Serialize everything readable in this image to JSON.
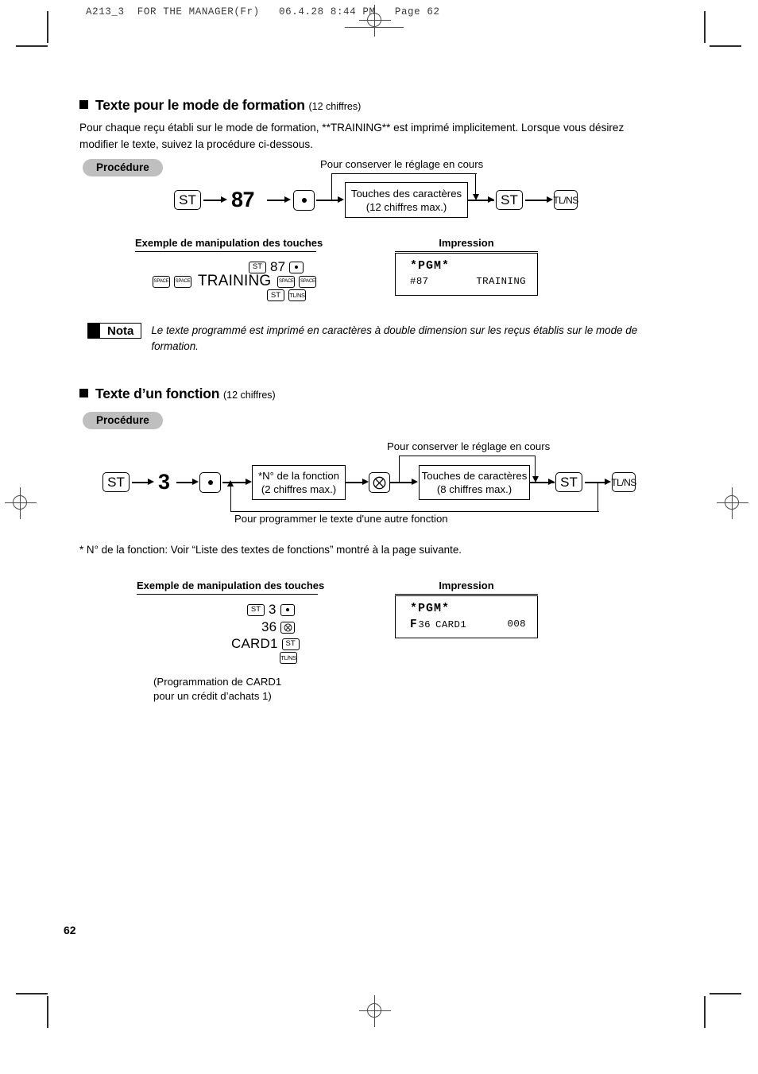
{
  "page": {
    "running_head": "A213_3  FOR THE MANAGER(Fr)   06.4.28 8:44 PM   Page 62",
    "page_number": "62"
  },
  "section1": {
    "heading": "Texte pour le mode de formation",
    "heading_qty": "(12 chiffres)",
    "body": "Pour chaque reçu établi sur le mode de formation, **TRAINING** est imprimé implicitement. Lorsque vous désirez modifier le texte, suivez la procédure ci-dessous.",
    "procedure_label": "Procédure",
    "flow": {
      "key_st": "ST",
      "number": "87",
      "key_dot": "dot-key",
      "loop_label": "Pour conserver le réglage en cours",
      "box_line1": "Touches des caractères",
      "box_line2": "(12 chiffres max.)",
      "key_st2": "ST",
      "key_tlns": "TL/NS"
    },
    "example": {
      "heading": "Exemple de manipulation des touches",
      "row1": {
        "st": "ST",
        "num": "87",
        "dot": "dot-key"
      },
      "row2": {
        "space1": "SPACE",
        "space2": "SPACE",
        "text": "TRAINING",
        "space3": "SPACE",
        "space4": "SPACE"
      },
      "row3": {
        "st": "ST",
        "tlns": "TL/NS"
      }
    },
    "impression": {
      "heading": "Impression",
      "pgm": "*PGM*",
      "left": "#87",
      "right": "TRAINING"
    },
    "nota": {
      "label": "Nota",
      "text": "Le texte programmé est imprimé en caractères à double dimension sur les reçus établis sur le mode de formation."
    }
  },
  "section2": {
    "heading": "Texte d’un fonction",
    "heading_qty": "(12 chiffres)",
    "procedure_label": "Procédure",
    "flow": {
      "key_st": "ST",
      "number": "3",
      "key_dot": "dot-key",
      "box1_line1": "*N° de la fonction",
      "box1_line2": "(2 chiffres max.)",
      "key_mul": "multiply-key",
      "loop_label": "Pour conserver le réglage en cours",
      "box2_line1": "Touches de caractères",
      "box2_line2": "(8 chiffres max.)",
      "key_st2": "ST",
      "key_tlns": "TL/NS",
      "loop_label_bottom": "Pour programmer le texte d'une autre fonction"
    },
    "footnote": "* N° de la fonction: Voir “Liste des textes de fonctions” montré à la page suivante.",
    "example": {
      "heading": "Exemple de manipulation des touches",
      "row1": {
        "st": "ST",
        "num": "3",
        "dot": "dot-key"
      },
      "row2": {
        "num": "36",
        "mul": "multiply-key"
      },
      "row3": {
        "text": "CARD1",
        "st": "ST"
      },
      "row4": {
        "tlns": "TL/NS"
      },
      "note_line1": "(Programmation de CARD1",
      "note_line2": "pour un crédit d’achats 1)"
    },
    "impression": {
      "heading": "Impression",
      "pgm": "*PGM*",
      "f": "F",
      "code": "36",
      "text": "CARD1",
      "right": "008"
    }
  }
}
